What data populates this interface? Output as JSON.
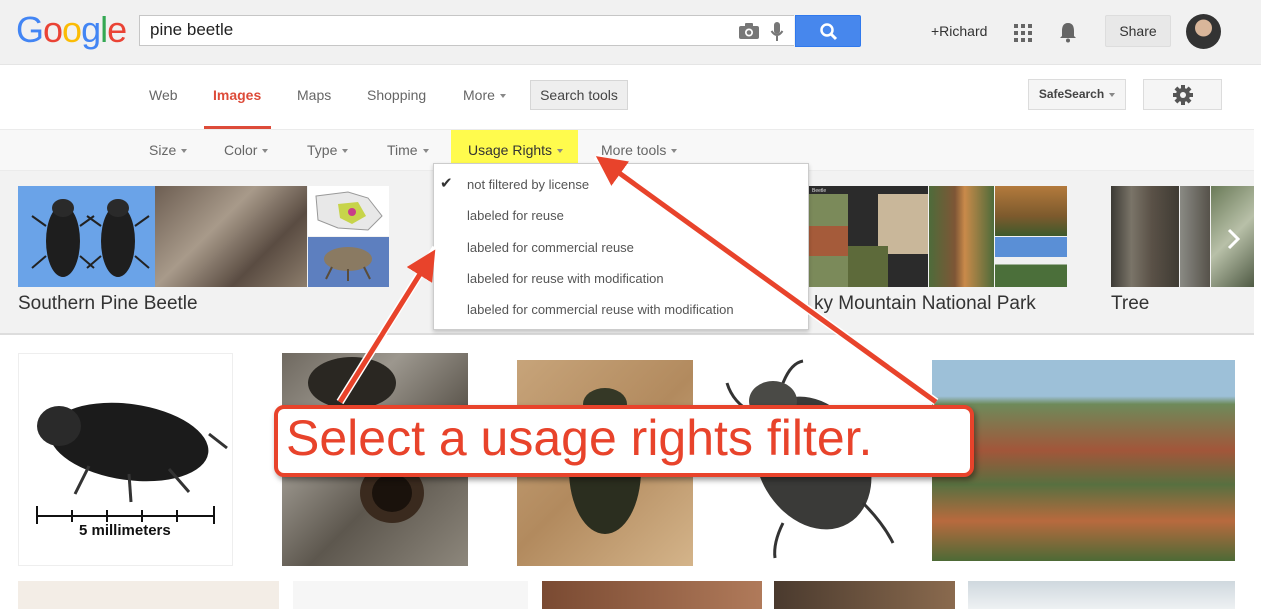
{
  "header": {
    "logo_letters": [
      "G",
      "o",
      "o",
      "g",
      "l",
      "e"
    ],
    "logo_colors": [
      "#4285f4",
      "#ea4335",
      "#fbbc05",
      "#4285f4",
      "#34a853",
      "#ea4335"
    ],
    "search_value": "pine beetle",
    "user_link": "+Richard",
    "share_label": "Share",
    "search_button_color": "#4787ed"
  },
  "nav": {
    "items": [
      "Web",
      "Images",
      "Maps",
      "Shopping",
      "More"
    ],
    "search_tools": "Search tools",
    "safesearch": "SafeSearch",
    "active_color": "#dd4b39"
  },
  "tools": {
    "items": [
      "Size",
      "Color",
      "Type",
      "Time",
      "Usage Rights",
      "More tools"
    ],
    "highlight_color": "#fffb4d"
  },
  "dropdown": {
    "options": [
      "not filtered by license",
      "labeled for reuse",
      "labeled for commercial reuse",
      "labeled for reuse with modification",
      "labeled for commercial reuse with modification"
    ],
    "selected": "not filtered by license"
  },
  "related": {
    "labels": [
      "Southern Pine Beetle",
      "ky Mountain National Park",
      "Tree"
    ]
  },
  "results": {
    "scale_label": "5 millimeters"
  },
  "annotation": {
    "text": "Select a usage rights filter.",
    "color": "#e8432b"
  }
}
